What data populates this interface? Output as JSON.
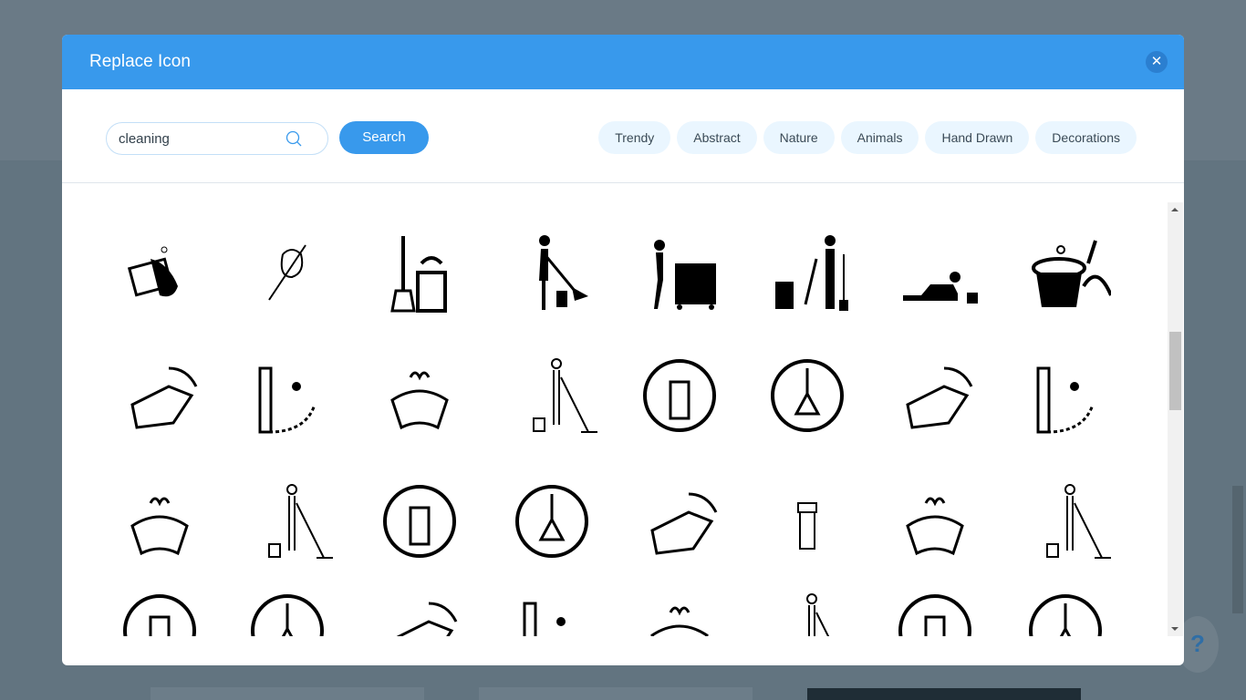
{
  "dialog": {
    "title": "Replace Icon",
    "close_icon": "close-icon",
    "accent": "#3899ec"
  },
  "search": {
    "value": "cleaning",
    "placeholder": "",
    "button_label": "Search"
  },
  "categories": [
    "Trendy",
    "Abstract",
    "Nature",
    "Animals",
    "Hand Drawn",
    "Decorations"
  ],
  "icons": [
    "washing-hands",
    "cleaning-robot-sketch",
    "broom-and-bucket",
    "person-sweeping",
    "person-floor-scrubber",
    "janitor-with-toilet",
    "person-scrubbing-floor",
    "bucket-and-duster",
    "person-mopping",
    "mop-and-bucket",
    "spray-bottle-circle",
    "broom-circle",
    "hand-with-sponge",
    "cleaning-route",
    "dustpan-brush",
    "person-with-mop",
    "mop-bucket-solid",
    "duster",
    "brush",
    "broom-bucket-bubbles",
    "foam-bucket",
    "spray-bottle",
    "small-broom",
    "mop-bucket-outline",
    "bucket-outline",
    "dustpan-and-broom",
    "mop-and-foam-bucket",
    "broom-and-bucket-outline",
    "bucket-and-mop",
    "cleaning-cart",
    "toothbrush",
    "spray-with-sparkles"
  ],
  "help": {
    "label": "?"
  }
}
